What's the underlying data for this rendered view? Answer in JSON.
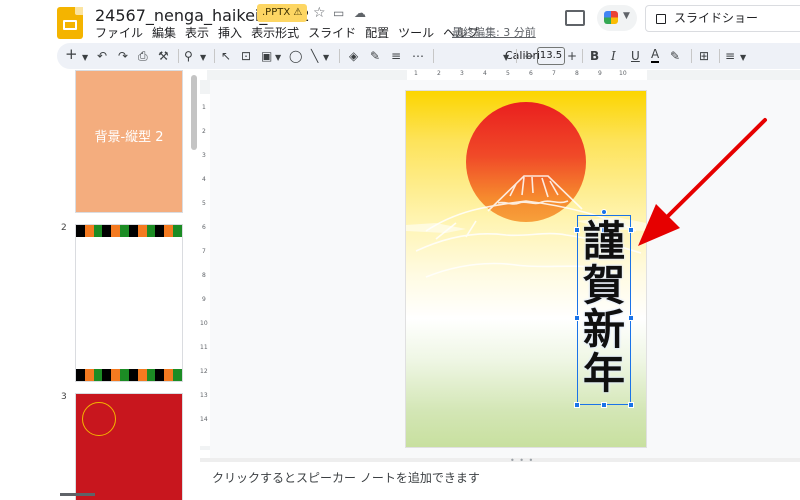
{
  "header": {
    "title": "24567_nenga_haikei_tate2",
    "badge": ".PPTX ⚠",
    "last_edit": "最終編集: 3 分前",
    "slideshow_label": "スライドショー",
    "menu": [
      "ファイル",
      "編集",
      "表示",
      "挿入",
      "表示形式",
      "スライド",
      "配置",
      "ツール",
      "ヘルプ"
    ]
  },
  "toolbar": {
    "font_name": "Calibri",
    "font_size": "13.5",
    "bold": "B",
    "italic": "I",
    "underline": "U",
    "text_color": "A"
  },
  "slides_panel": {
    "slides": [
      {
        "number": "",
        "label": "背景-縦型 2"
      },
      {
        "number": "2",
        "label": ""
      },
      {
        "number": "3",
        "label": ""
      }
    ]
  },
  "ruler": {
    "h_numbers": [
      "1",
      "2",
      "3",
      "4",
      "5",
      "6",
      "7",
      "8",
      "9",
      "10"
    ],
    "v_numbers": [
      "1",
      "2",
      "3",
      "4",
      "5",
      "6",
      "7",
      "8",
      "9",
      "10",
      "11",
      "12",
      "13",
      "14"
    ]
  },
  "slide": {
    "greeting": [
      "謹",
      "賀",
      "新",
      "年"
    ]
  },
  "notes": {
    "placeholder": "クリックするとスピーカー ノートを追加できます"
  },
  "colors": {
    "accent_blue": "#1a73e8",
    "arrow_red": "#e60000",
    "thumb1": "#f4ad7e",
    "thumb3": "#c8161e",
    "stripe": [
      "#000000",
      "#f47a20",
      "#1c8c24"
    ]
  }
}
